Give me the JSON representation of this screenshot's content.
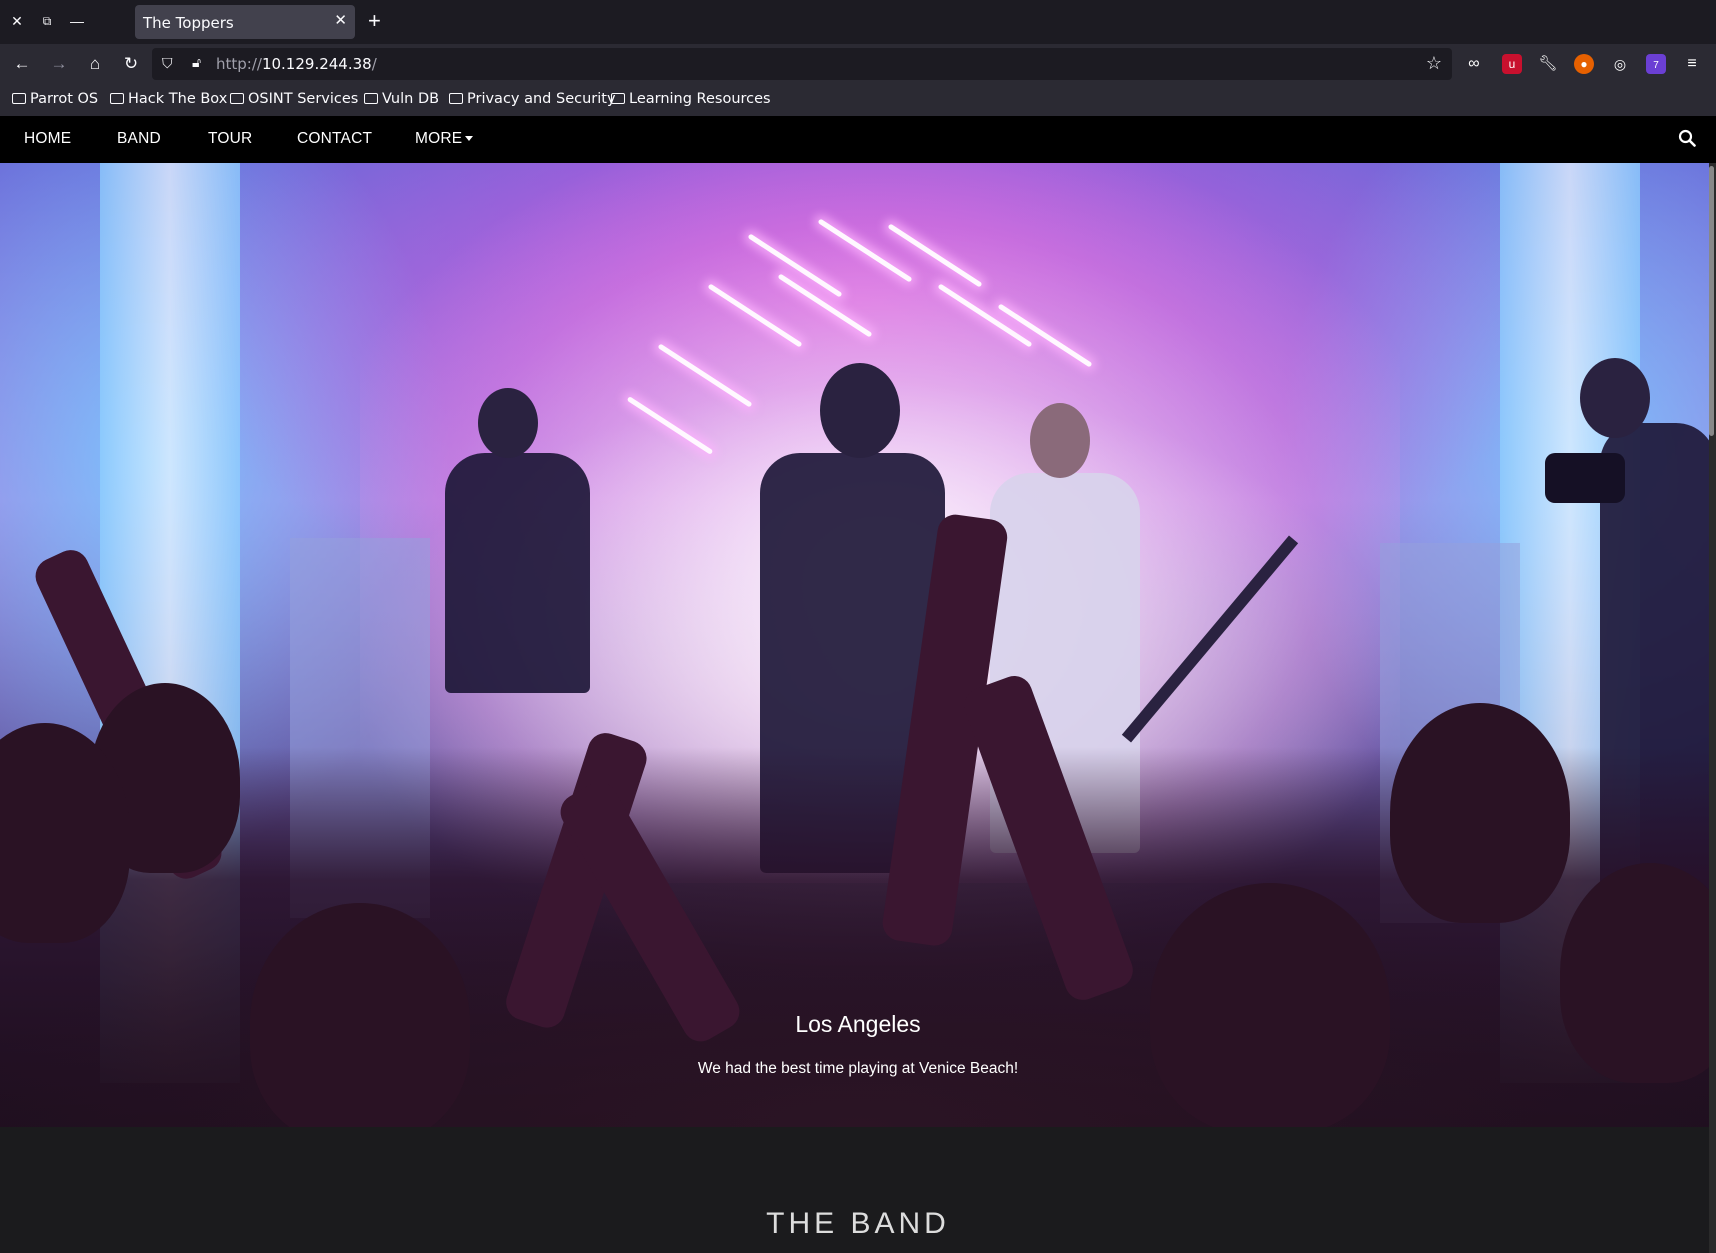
{
  "browser": {
    "tab_title": "The Toppers",
    "url_protocol": "http://",
    "url_host": "10.129.244.38",
    "url_path": "/",
    "extension_badge": "7",
    "bookmarks": [
      "Parrot OS",
      "Hack The Box",
      "OSINT Services",
      "Vuln DB",
      "Privacy and Security",
      "Learning Resources"
    ]
  },
  "site": {
    "nav": {
      "home": "HOME",
      "band": "BAND",
      "tour": "TOUR",
      "contact": "CONTACT",
      "more": "MORE"
    },
    "hero": {
      "title": "Los Angeles",
      "subtitle": "We had the best time playing at Venice Beach!"
    },
    "band_section": {
      "title": "THE BAND"
    }
  },
  "colors": {
    "site_nav_bg": "#000000",
    "page_bg": "#1b1b1d",
    "browser_bg": "#1c1b22",
    "toolbar_bg": "#2b2a33"
  }
}
